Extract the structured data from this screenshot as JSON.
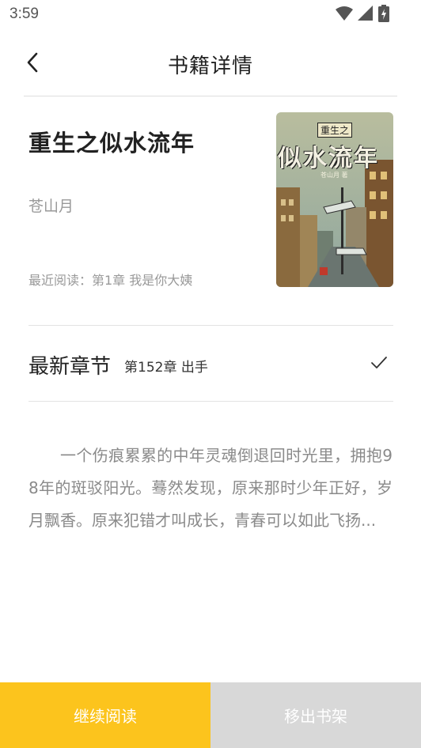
{
  "status_bar": {
    "time": "3:59",
    "icons": [
      "wifi-icon",
      "signal-icon",
      "battery-charging-icon"
    ]
  },
  "header": {
    "title": "书籍详情",
    "back_icon": "chevron-left-icon"
  },
  "book": {
    "title": "重生之似水流年",
    "author": "苍山月",
    "recent_read": "最近阅读：第1章 我是你大姨",
    "cover": {
      "small_title": "重生之",
      "big_title": "似水流年",
      "author_line": "苍山月 著"
    }
  },
  "latest": {
    "label": "最新章节",
    "chapter": "第152章 出手",
    "icon": "check-icon"
  },
  "description": "一个伤痕累累的中年灵魂倒退回时光里，拥抱98年的斑驳阳光。蓦然发现，原来那时少年正好，岁月飘香。原来犯错才叫成长，青春可以如此飞扬...",
  "actions": {
    "continue_label": "继续阅读",
    "remove_label": "移出书架"
  },
  "colors": {
    "accent": "#fcc41d",
    "disabled": "#d8d8d8",
    "secondary_text": "#999999"
  }
}
